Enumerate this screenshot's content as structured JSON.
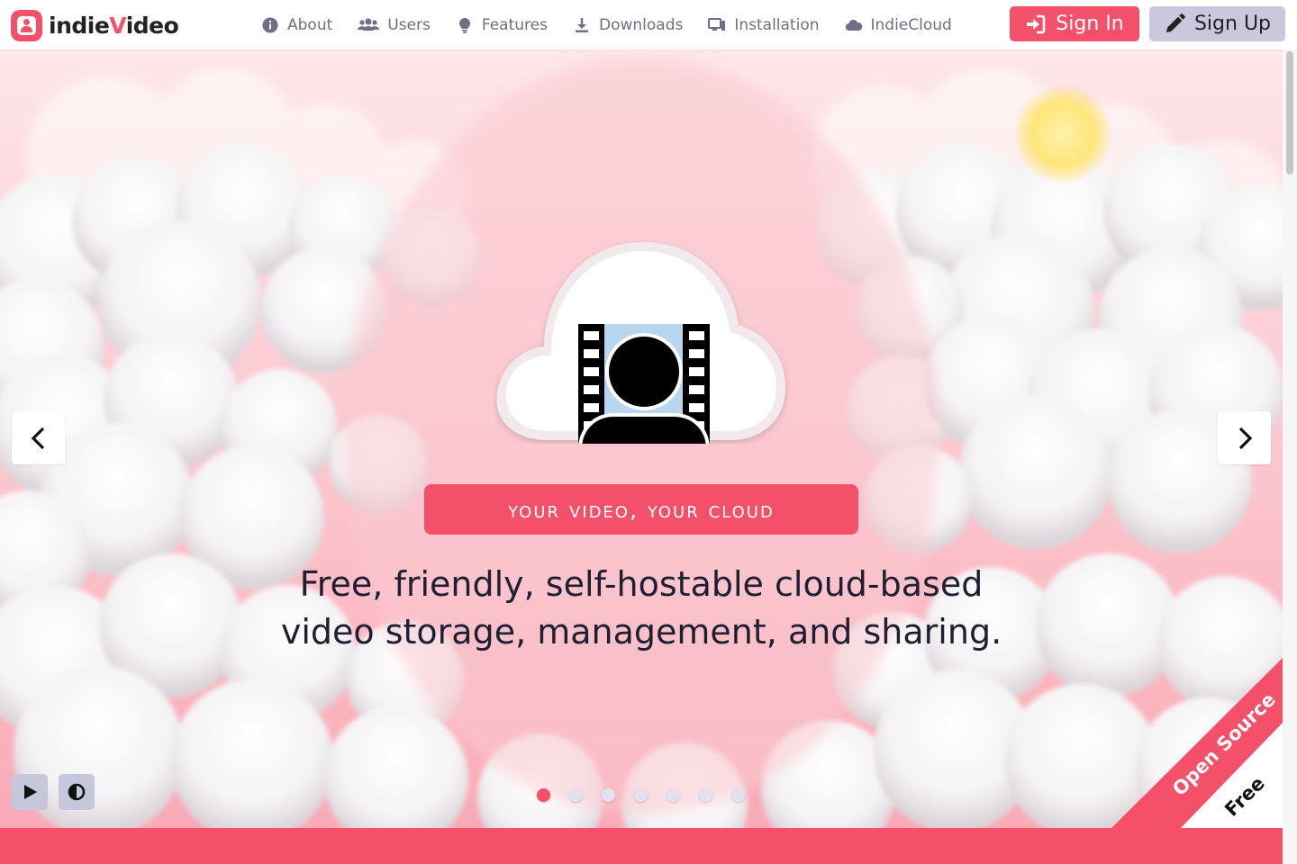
{
  "brand": {
    "prefix": "indie",
    "accent_letter": "V",
    "suffix": "ideo",
    "accent_color": "#f4506a"
  },
  "nav": {
    "items": [
      {
        "label": "About",
        "icon": "info-circle-icon"
      },
      {
        "label": "Users",
        "icon": "users-icon"
      },
      {
        "label": "Features",
        "icon": "lightbulb-icon"
      },
      {
        "label": "Downloads",
        "icon": "download-icon"
      },
      {
        "label": "Installation",
        "icon": "desktop-icon"
      },
      {
        "label": "IndieCloud",
        "icon": "cloud-icon"
      }
    ]
  },
  "auth": {
    "sign_in_label": "Sign In",
    "sign_up_label": "Sign Up"
  },
  "hero": {
    "tagline": "Your Video, Your Cloud",
    "headline_line1": "Free, friendly, self-hostable cloud-based",
    "headline_line2": "video storage, management, and sharing.",
    "slide_count": 7,
    "active_slide": 1
  },
  "ribbon": {
    "primary": "Open Source",
    "secondary": "Free"
  },
  "colors": {
    "primary": "#f4506a",
    "secondary": "#c9c8dc",
    "nav_text": "#6e6e86",
    "headline": "#1f1f33"
  }
}
